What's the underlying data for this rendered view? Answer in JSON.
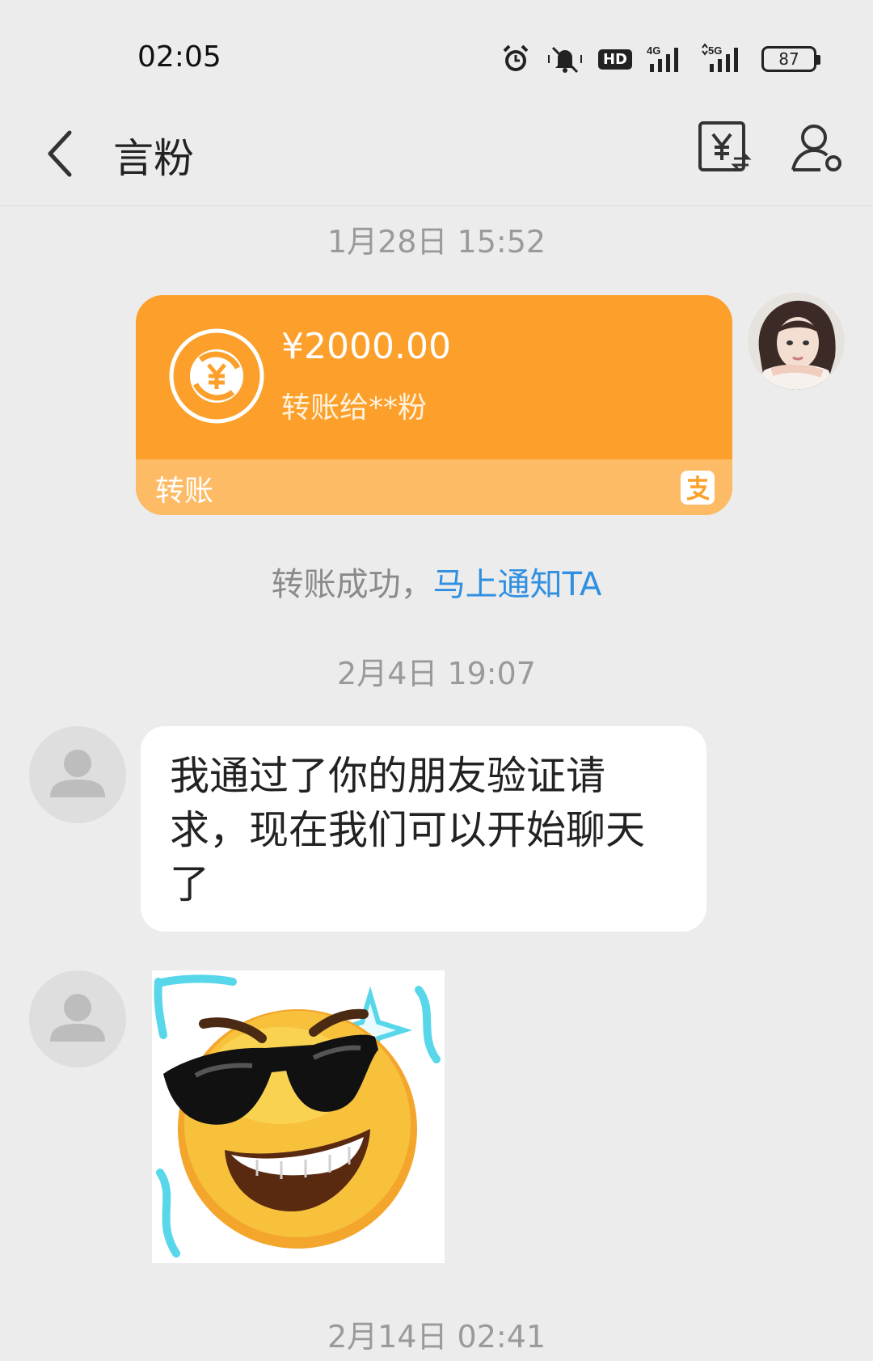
{
  "status_bar": {
    "time": "02:05",
    "network_4g": "4G",
    "network_5g": "5G",
    "hd": "HD",
    "battery": "87"
  },
  "nav": {
    "title": "言粉",
    "back_icon": "chevron-left-icon",
    "transfer_icon": "yuan-transfer-icon",
    "profile_icon": "user-settings-icon"
  },
  "messages": {
    "ts1": "1月28日 15:52",
    "transfer": {
      "amount": "¥2000.00",
      "to": "转账给**粉",
      "label": "转账",
      "accent": "#fca02b"
    },
    "notice": {
      "text": "转账成功，",
      "link": "马上通知TA",
      "link_color": "#2f8fe0"
    },
    "ts2": "2月4日 19:07",
    "text_message": "我通过了你的朋友验证请求，现在我们可以开始聊天了",
    "ts3": "2月14日 02:41"
  }
}
